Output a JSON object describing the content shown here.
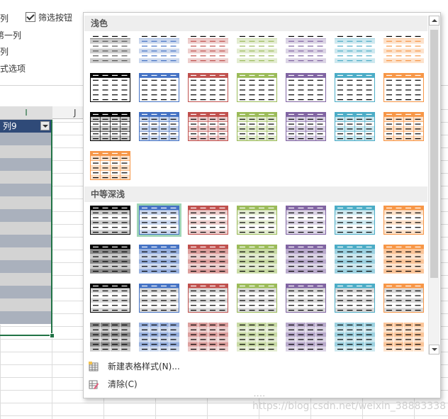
{
  "ribbon": {
    "col_item": "列",
    "filter_button_label": "筛选按钮",
    "first_col": "第一列",
    "last_col": "列",
    "style_options": "式选项"
  },
  "sheet": {
    "col_headers": [
      "I",
      "J"
    ],
    "table_header": "列9"
  },
  "gallery": {
    "section_light": "浅色",
    "section_medium": "中等深浅",
    "colors": {
      "black": "#000000",
      "blue": "#4472c4",
      "red": "#c0504d",
      "green": "#9bbb59",
      "purple": "#8064a2",
      "aqua": "#4bacc6",
      "orange": "#f79646",
      "selection": "#9fd5b6"
    },
    "new_style_label": "新建表格样式(N)...",
    "clear_label": "清除(C)",
    "grip": "....",
    "icons": [
      "new-table-style-icon",
      "clear-icon",
      "scroll-up-icon",
      "scroll-down-icon",
      "filter-dropdown-icon",
      "checkbox-icon"
    ]
  },
  "watermark": "https://blog.csdn.net/weixin_38883338"
}
